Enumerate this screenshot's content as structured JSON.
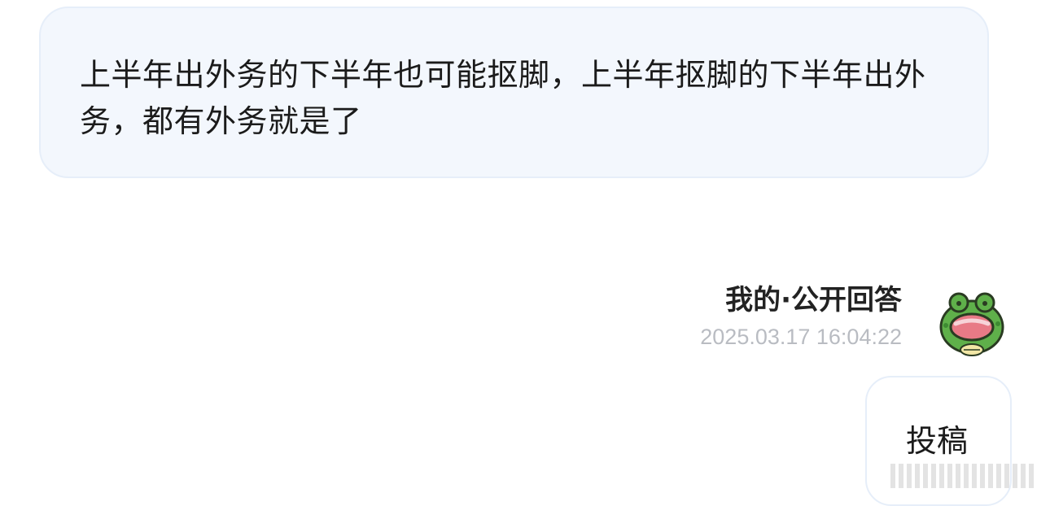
{
  "question": {
    "text": "上半年出外务的下半年也可能抠脚，上半年抠脚的下半年出外务，都有外务就是了"
  },
  "answer": {
    "title": "我的·公开回答",
    "timestamp": "2025.03.17 16:04:22",
    "avatar_icon": "green-frog-avatar-icon",
    "reply_text": "投稿"
  },
  "colors": {
    "question_bubble_bg": "#f3f7fd",
    "bubble_border": "#e6eef9",
    "timestamp_gray": "#b9bcc2",
    "frog_green": "#5fb04a",
    "frog_mouth": "#e87a86"
  }
}
